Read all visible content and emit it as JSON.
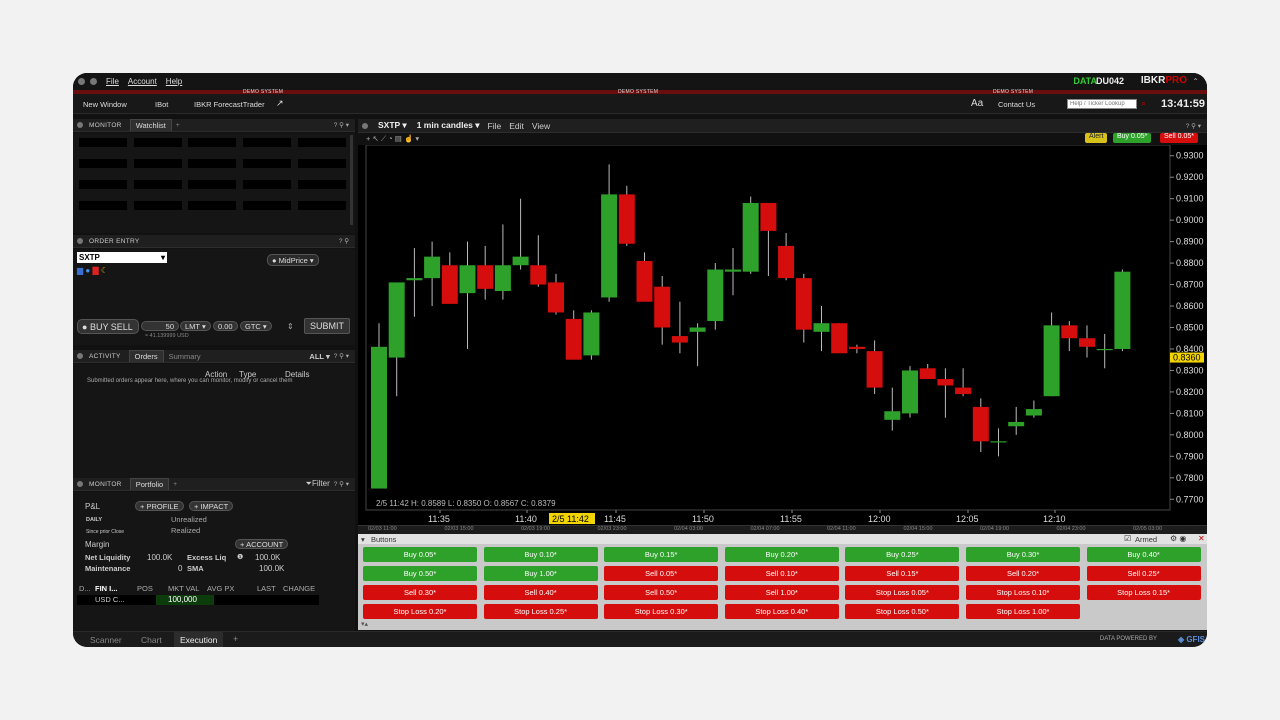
{
  "menu": {
    "file": "File",
    "account": "Account",
    "help": "Help"
  },
  "status": {
    "data_label": "DATA",
    "account_id": "DU042",
    "brand": "IBKR",
    "brand_suffix": "PRO"
  },
  "demo_banner": "DEMO SYSTEM",
  "toolbar": {
    "new_window": "New Window",
    "ibot": "IBot",
    "forecast": "IBKR ForecastTrader",
    "font": "Aa",
    "contact": "Contact Us",
    "search_placeholder": "Help / Ticker Lookup",
    "clock": "13:41:59"
  },
  "watchlist": {
    "monitor": "MONITOR",
    "tab": "Watchlist",
    "add": "+"
  },
  "order_entry": {
    "title": "ORDER ENTRY",
    "symbol": "SXTP",
    "midprice": "MidPrice",
    "buy": "BUY",
    "sell": "SELL",
    "qty": "50",
    "type": "LMT",
    "price": "0.00",
    "tif": "GTC",
    "sub_info": "≈ 41.139999 USD",
    "submit": "SUBMIT"
  },
  "activity": {
    "title": "ACTIVITY",
    "tab_orders": "Orders",
    "tab_summary": "Summary",
    "filter": "ALL",
    "col_action": "Action",
    "col_type": "Type",
    "col_details": "Details",
    "message": "Submitted orders appear here, where you can monitor, modify or cancel them"
  },
  "portfolio": {
    "monitor": "MONITOR",
    "tab": "Portfolio",
    "filter": "Filter",
    "pnl": "P&L",
    "profile": "PROFILE",
    "impact": "IMPACT",
    "daily": "DAILY",
    "since": "Since prior Close",
    "unrealized": "Unrealized",
    "realized": "Realized",
    "margin": "Margin",
    "account_btn": "ACCOUNT",
    "net_liq_label": "Net Liquidity",
    "net_liq": "100.0K",
    "excess_label": "Excess Liq",
    "excess": "100.0K",
    "maint_label": "Maintenance",
    "maint": "0",
    "sma_label": "SMA",
    "sma": "100.0K",
    "columns": [
      "D...",
      "FIN I...",
      "POS",
      "MKT VAL",
      "AVG PX",
      "LAST",
      "CHANGE"
    ],
    "row": {
      "fin": "USD C...",
      "mkt_val": "100,000"
    }
  },
  "bottom_tabs": [
    "Scanner",
    "Chart",
    "Execution",
    "+"
  ],
  "data_powered": "DATA POWERED BY",
  "gfis": "GFIS",
  "chart_header": {
    "symbol": "SXTP",
    "interval": "1 min candles",
    "file": "File",
    "edit": "Edit",
    "view": "View",
    "alert": "Alert",
    "buy": "Buy 0.05*",
    "sell": "Sell 0.05*",
    "current_price": "0.8360",
    "crosshair_time": "2/5 11:42",
    "ohlc_text": "2/5 11:42  H: 0.8589  L: 0.8350  O: 0.8567  C: 0.8379"
  },
  "chart_data": {
    "type": "candlestick",
    "x_labels": [
      "11:35",
      "11:40",
      "11:45",
      "11:50",
      "11:55",
      "12:00",
      "12:05",
      "12:10"
    ],
    "mini_labels": [
      "02/03 11:00",
      "02/03 15:00",
      "02/03 19:00",
      "02/03 23:00",
      "02/04 03:00",
      "02/04 07:00",
      "02/04 11:00",
      "02/04 15:00",
      "02/04 19:00",
      "02/04 23:00",
      "02/05 03:00"
    ],
    "ylim": [
      0.765,
      0.935
    ],
    "y_ticks": [
      "0.9300",
      "0.9200",
      "0.9100",
      "0.9000",
      "0.8900",
      "0.8800",
      "0.8700",
      "0.8600",
      "0.8500",
      "0.8400",
      "0.8300",
      "0.8200",
      "0.8100",
      "0.8000",
      "0.7900",
      "0.7800",
      "0.7700"
    ],
    "candles": [
      {
        "o": 0.775,
        "h": 0.852,
        "l": 0.775,
        "c": 0.841
      },
      {
        "o": 0.836,
        "h": 0.855,
        "l": 0.818,
        "c": 0.871
      },
      {
        "o": 0.872,
        "h": 0.887,
        "l": 0.855,
        "c": 0.873
      },
      {
        "o": 0.873,
        "h": 0.89,
        "l": 0.86,
        "c": 0.883
      },
      {
        "o": 0.879,
        "h": 0.885,
        "l": 0.864,
        "c": 0.861
      },
      {
        "o": 0.866,
        "h": 0.89,
        "l": 0.84,
        "c": 0.879
      },
      {
        "o": 0.879,
        "h": 0.888,
        "l": 0.863,
        "c": 0.868
      },
      {
        "o": 0.867,
        "h": 0.898,
        "l": 0.863,
        "c": 0.879
      },
      {
        "o": 0.879,
        "h": 0.91,
        "l": 0.877,
        "c": 0.883
      },
      {
        "o": 0.879,
        "h": 0.893,
        "l": 0.869,
        "c": 0.87
      },
      {
        "o": 0.871,
        "h": 0.875,
        "l": 0.856,
        "c": 0.857
      },
      {
        "o": 0.854,
        "h": 0.858,
        "l": 0.838,
        "c": 0.835
      },
      {
        "o": 0.837,
        "h": 0.858,
        "l": 0.835,
        "c": 0.857
      },
      {
        "o": 0.864,
        "h": 0.926,
        "l": 0.862,
        "c": 0.912
      },
      {
        "o": 0.912,
        "h": 0.916,
        "l": 0.888,
        "c": 0.889
      },
      {
        "o": 0.881,
        "h": 0.885,
        "l": 0.867,
        "c": 0.862
      },
      {
        "o": 0.869,
        "h": 0.874,
        "l": 0.842,
        "c": 0.85
      },
      {
        "o": 0.846,
        "h": 0.862,
        "l": 0.838,
        "c": 0.843
      },
      {
        "o": 0.848,
        "h": 0.852,
        "l": 0.832,
        "c": 0.85
      },
      {
        "o": 0.853,
        "h": 0.88,
        "l": 0.849,
        "c": 0.877
      },
      {
        "o": 0.876,
        "h": 0.887,
        "l": 0.865,
        "c": 0.877
      },
      {
        "o": 0.876,
        "h": 0.911,
        "l": 0.875,
        "c": 0.908
      },
      {
        "o": 0.908,
        "h": 0.908,
        "l": 0.874,
        "c": 0.895
      },
      {
        "o": 0.888,
        "h": 0.894,
        "l": 0.872,
        "c": 0.873
      },
      {
        "o": 0.873,
        "h": 0.875,
        "l": 0.843,
        "c": 0.849
      },
      {
        "o": 0.848,
        "h": 0.86,
        "l": 0.839,
        "c": 0.852
      },
      {
        "o": 0.852,
        "h": 0.852,
        "l": 0.84,
        "c": 0.838
      },
      {
        "o": 0.841,
        "h": 0.842,
        "l": 0.838,
        "c": 0.84
      },
      {
        "o": 0.839,
        "h": 0.844,
        "l": 0.819,
        "c": 0.822
      },
      {
        "o": 0.807,
        "h": 0.822,
        "l": 0.802,
        "c": 0.811
      },
      {
        "o": 0.81,
        "h": 0.832,
        "l": 0.808,
        "c": 0.83
      },
      {
        "o": 0.831,
        "h": 0.833,
        "l": 0.827,
        "c": 0.826
      },
      {
        "o": 0.826,
        "h": 0.831,
        "l": 0.808,
        "c": 0.823
      },
      {
        "o": 0.822,
        "h": 0.831,
        "l": 0.818,
        "c": 0.819
      },
      {
        "o": 0.813,
        "h": 0.817,
        "l": 0.792,
        "c": 0.797
      },
      {
        "o": 0.797,
        "h": 0.803,
        "l": 0.79,
        "c": 0.797
      },
      {
        "o": 0.804,
        "h": 0.813,
        "l": 0.8,
        "c": 0.806
      },
      {
        "o": 0.809,
        "h": 0.816,
        "l": 0.808,
        "c": 0.812
      },
      {
        "o": 0.818,
        "h": 0.857,
        "l": 0.818,
        "c": 0.851
      },
      {
        "o": 0.851,
        "h": 0.853,
        "l": 0.839,
        "c": 0.845
      },
      {
        "o": 0.845,
        "h": 0.851,
        "l": 0.836,
        "c": 0.841
      },
      {
        "o": 0.84,
        "h": 0.847,
        "l": 0.831,
        "c": 0.84
      },
      {
        "o": 0.84,
        "h": 0.877,
        "l": 0.839,
        "c": 0.876
      }
    ]
  },
  "buttons_panel": {
    "title": "Buttons",
    "armed": "Armed",
    "rows": [
      [
        {
          "label": "Buy 0.05*",
          "color": "green"
        },
        {
          "label": "Buy 0.10*",
          "color": "green"
        },
        {
          "label": "Buy 0.15*",
          "color": "green"
        },
        {
          "label": "Buy 0.20*",
          "color": "green"
        },
        {
          "label": "Buy 0.25*",
          "color": "green"
        },
        {
          "label": "Buy 0.30*",
          "color": "green"
        },
        {
          "label": "Buy 0.40*",
          "color": "green"
        }
      ],
      [
        {
          "label": "Buy 0.50*",
          "color": "green"
        },
        {
          "label": "Buy 1.00*",
          "color": "green"
        },
        {
          "label": "Sell 0.05*",
          "color": "red"
        },
        {
          "label": "Sell 0.10*",
          "color": "red"
        },
        {
          "label": "Sell 0.15*",
          "color": "red"
        },
        {
          "label": "Sell 0.20*",
          "color": "red"
        },
        {
          "label": "Sell 0.25*",
          "color": "red"
        }
      ],
      [
        {
          "label": "Sell 0.30*",
          "color": "red"
        },
        {
          "label": "Sell 0.40*",
          "color": "red"
        },
        {
          "label": "Sell 0.50*",
          "color": "red"
        },
        {
          "label": "Sell 1.00*",
          "color": "red"
        },
        {
          "label": "Stop Loss 0.05*",
          "color": "red"
        },
        {
          "label": "Stop Loss 0.10*",
          "color": "red"
        },
        {
          "label": "Stop Loss 0.15*",
          "color": "red"
        }
      ],
      [
        {
          "label": "Stop Loss 0.20*",
          "color": "red"
        },
        {
          "label": "Stop Loss 0.25*",
          "color": "red"
        },
        {
          "label": "Stop Loss 0.30*",
          "color": "red"
        },
        {
          "label": "Stop Loss 0.40*",
          "color": "red"
        },
        {
          "label": "Stop Loss 0.50*",
          "color": "red"
        },
        {
          "label": "Stop Loss 1.00*",
          "color": "red"
        }
      ]
    ]
  },
  "colors": {
    "up": "#2ea12b",
    "down": "#d60d0d",
    "price_tag": "#f2d400",
    "alert": "#d6c21a"
  }
}
